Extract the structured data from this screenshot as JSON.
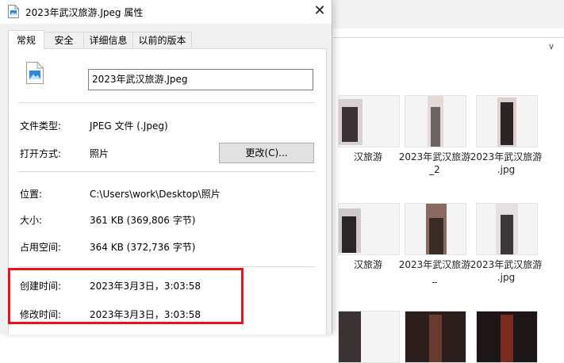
{
  "dialog": {
    "title": "2023年武汉旅游.Jpeg 属性",
    "close_glyph": "✕",
    "tabs": [
      {
        "label": "常规",
        "active": true
      },
      {
        "label": "安全",
        "active": false
      },
      {
        "label": "详细信息",
        "active": false
      },
      {
        "label": "以前的版本",
        "active": false
      }
    ],
    "filename": "2023年武汉旅游.Jpeg",
    "file_type": {
      "label": "文件类型:",
      "value": "JPEG 文件 (.Jpeg)"
    },
    "opens_with": {
      "label": "打开方式:",
      "value": "照片",
      "button": "更改(C)..."
    },
    "location": {
      "label": "位置:",
      "value": "C:\\Users\\work\\Desktop\\照片"
    },
    "size": {
      "label": "大小:",
      "value": "361 KB (369,806 字节)"
    },
    "size_on_disk": {
      "label": "占用空间:",
      "value": "364 KB (372,736 字节)"
    },
    "created": {
      "label": "创建时间:",
      "value": "2023年3月3日，3:03:58"
    },
    "modified": {
      "label": "修改时间:",
      "value": "2023年3月3日，3:03:58"
    },
    "highlight_color": "#e8141b",
    "icon": "photo-file-icon"
  },
  "explorer": {
    "chevron_glyph": "∨",
    "tiles": [
      {
        "label": "汉旅游"
      },
      {
        "label": "2023年武汉旅游\n_2"
      },
      {
        "label": "2023年武汉旅游\n.jpg"
      },
      {
        "label": "汉旅游"
      },
      {
        "label": "2023年武汉旅游\n_"
      },
      {
        "label": "2023年武汉旅游\n.jpg"
      }
    ]
  }
}
